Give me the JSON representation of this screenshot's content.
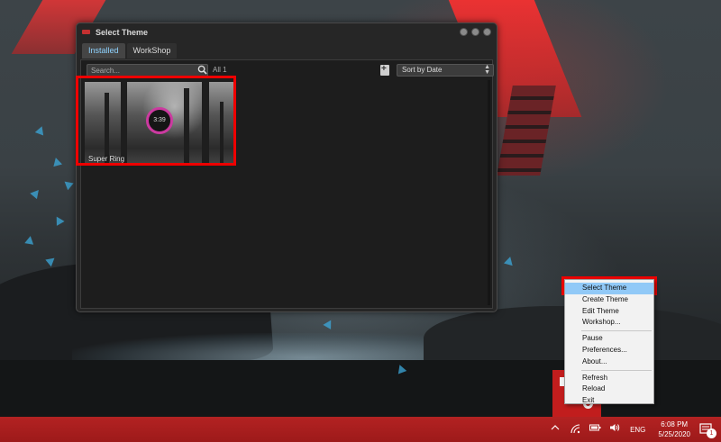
{
  "window": {
    "title": "Select Theme",
    "tabs": [
      {
        "label": "Installed",
        "active": true
      },
      {
        "label": "WorkShop",
        "active": false
      }
    ],
    "search": {
      "placeholder": "Search...",
      "value": ""
    },
    "count_label": "All 1",
    "sort": {
      "selected": "Sort by Date"
    },
    "themes": [
      {
        "name": "Super Ring",
        "clock_text": "3:39"
      }
    ]
  },
  "context_menu": {
    "items": [
      {
        "label": "Select Theme",
        "selected": true
      },
      {
        "label": "Create Theme"
      },
      {
        "label": "Edit Theme"
      },
      {
        "label": "Workshop..."
      },
      {
        "separator": true
      },
      {
        "label": "Pause"
      },
      {
        "label": "Preferences..."
      },
      {
        "label": "About..."
      },
      {
        "separator": true
      },
      {
        "label": "Refresh"
      },
      {
        "label": "Reload"
      },
      {
        "label": "Exit"
      }
    ]
  },
  "taskbar": {
    "language": "ENG",
    "time": "6:08 PM",
    "date": "5/25/2020",
    "notification_count": "1",
    "tray_icons": [
      "chevron-up-icon",
      "wifi-icon",
      "battery-icon",
      "volume-icon"
    ]
  },
  "colors": {
    "taskbar": "#b32222",
    "highlight": "#ee0000",
    "tab_active_text": "#8fd3ff",
    "menu_selected": "#91c9f7"
  }
}
